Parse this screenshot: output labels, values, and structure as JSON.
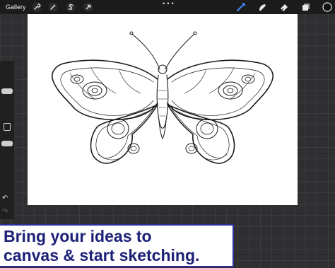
{
  "toolbar": {
    "gallery_label": "Gallery",
    "more_label": "•••",
    "left_tools": [
      "wrench-icon",
      "magic-wand-icon",
      "selection-icon",
      "transform-arrow-icon"
    ],
    "right_tools": [
      "brush-icon",
      "smudge-icon",
      "eraser-icon",
      "layers-icon",
      "color-swatch"
    ],
    "active_tool_color": "#3d8cff",
    "active_color": "#111111"
  },
  "sidebar": {
    "controls": [
      "brush-size-slider",
      "modify-button",
      "opacity-slider",
      "undo-icon",
      "redo-icon"
    ],
    "undo_label": "↶",
    "redo_label": "↷"
  },
  "canvas": {
    "background": "#ffffff",
    "artwork": "butterfly line sketch"
  },
  "caption": {
    "line1": "Bring your ideas to",
    "line2": "canvas & start sketching.",
    "text_color": "#1c2178",
    "border_color": "#2a2f9b"
  }
}
